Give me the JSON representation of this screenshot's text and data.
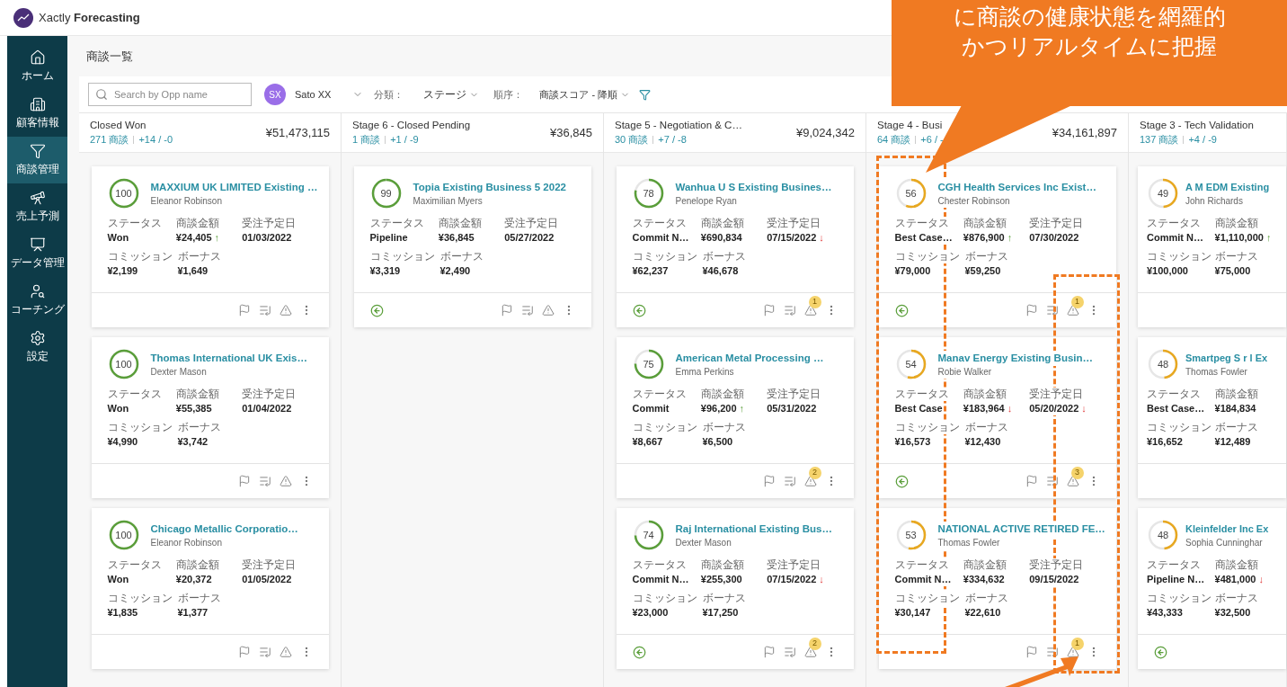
{
  "app": {
    "brand_light": "Xactly",
    "brand_bold": "Forecasting"
  },
  "sidebar": {
    "items": [
      {
        "label": "ホーム",
        "selected": false
      },
      {
        "label": "顧客情報",
        "selected": false
      },
      {
        "label": "商談管理",
        "selected": true
      },
      {
        "label": "売上予測",
        "selected": false
      },
      {
        "label": "データ管理",
        "selected": false
      },
      {
        "label": "コーチング",
        "selected": false
      },
      {
        "label": "設定",
        "selected": false
      }
    ]
  },
  "page_title": "商談一覧",
  "toolbar": {
    "search_placeholder": "Search by Opp name",
    "user_initials": "SX",
    "user_name": "Sato XX",
    "group_label": "分類：",
    "group_value": "ステージ",
    "order_label": "順序：",
    "order_value": "商談スコア - 降順"
  },
  "columns": [
    {
      "title": "Closed Won",
      "count": "271 商談",
      "delta": "+14 / -0",
      "amount": "¥51,473,115",
      "cards": [
        {
          "score": "100",
          "title": "MAXXIUM UK LIMITED Existing …",
          "owner": "Eleanor Robinson",
          "rows": [
            [
              {
                "label": "ステータス",
                "value": "Won"
              },
              {
                "label": "商談金額",
                "value": "¥24,405",
                "kind": "up",
                "arrow": "↑"
              },
              {
                "label": "受注予定日",
                "value": "01/03/2022"
              }
            ],
            [
              {
                "label": "コミッション",
                "value": "¥2,199"
              },
              {
                "label": "ボーナス",
                "value": "¥1,649"
              }
            ]
          ],
          "back": false,
          "tools": true
        },
        {
          "score": "100",
          "title": "Thomas International UK Exis…",
          "owner": "Dexter Mason",
          "rows": [
            [
              {
                "label": "ステータス",
                "value": "Won"
              },
              {
                "label": "商談金額",
                "value": "¥55,385"
              },
              {
                "label": "受注予定日",
                "value": "01/04/2022"
              }
            ],
            [
              {
                "label": "コミッション",
                "value": "¥4,990"
              },
              {
                "label": "ボーナス",
                "value": "¥3,742"
              }
            ]
          ],
          "back": false,
          "tools": true
        },
        {
          "score": "100",
          "title": "Chicago Metallic Corporatio…",
          "owner": "Eleanor Robinson",
          "rows": [
            [
              {
                "label": "ステータス",
                "value": "Won"
              },
              {
                "label": "商談金額",
                "value": "¥20,372"
              },
              {
                "label": "受注予定日",
                "value": "01/05/2022"
              }
            ],
            [
              {
                "label": "コミッション",
                "value": "¥1,835"
              },
              {
                "label": "ボーナス",
                "value": "¥1,377"
              }
            ]
          ],
          "back": false,
          "tools": true
        }
      ]
    },
    {
      "title": "Stage 6 - Closed Pending",
      "count": "1 商談",
      "delta": "+1 / -9",
      "amount": "¥36,845",
      "cards": [
        {
          "score": "99",
          "title": "Topia Existing Business 5 2022",
          "owner": "Maximilian Myers",
          "rows": [
            [
              {
                "label": "ステータス",
                "value": "Pipeline"
              },
              {
                "label": "商談金額",
                "value": "¥36,845"
              },
              {
                "label": "受注予定日",
                "value": "05/27/2022"
              }
            ],
            [
              {
                "label": "コミッション",
                "value": "¥3,319"
              },
              {
                "label": "ボーナス",
                "value": "¥2,490"
              }
            ]
          ],
          "back": true,
          "tools": true
        }
      ]
    },
    {
      "title": "Stage 5 - Negotiation & C…",
      "count": "30 商談",
      "delta": "+7 / -8",
      "amount": "¥9,024,342",
      "cards": [
        {
          "score": "78",
          "title": "Wanhua U S Existing Busines…",
          "owner": "Penelope Ryan",
          "rows": [
            [
              {
                "label": "ステータス",
                "value": "Commit N…"
              },
              {
                "label": "商談金額",
                "value": "¥690,834"
              },
              {
                "label": "受注予定日",
                "value": "07/15/2022",
                "kind": "down",
                "arrow": "↓"
              }
            ],
            [
              {
                "label": "コミッション",
                "value": "¥62,237"
              },
              {
                "label": "ボーナス",
                "value": "¥46,678"
              }
            ]
          ],
          "back": true,
          "tools": true,
          "alerts": "1"
        },
        {
          "score": "75",
          "title": "American Metal Processing …",
          "owner": "Emma Perkins",
          "rows": [
            [
              {
                "label": "ステータス",
                "value": "Commit"
              },
              {
                "label": "商談金額",
                "value": "¥96,200",
                "kind": "up",
                "arrow": "↑"
              },
              {
                "label": "受注予定日",
                "value": "05/31/2022"
              }
            ],
            [
              {
                "label": "コミッション",
                "value": "¥8,667"
              },
              {
                "label": "ボーナス",
                "value": "¥6,500"
              }
            ]
          ],
          "back": false,
          "tools": true,
          "alerts": "2"
        },
        {
          "score": "74",
          "title": "Raj International Existing Bus…",
          "owner": "Dexter Mason",
          "rows": [
            [
              {
                "label": "ステータス",
                "value": "Commit N…"
              },
              {
                "label": "商談金額",
                "value": "¥255,300"
              },
              {
                "label": "受注予定日",
                "value": "07/15/2022",
                "kind": "down",
                "arrow": "↓"
              }
            ],
            [
              {
                "label": "コミッション",
                "value": "¥23,000"
              },
              {
                "label": "ボーナス",
                "value": "¥17,250"
              }
            ]
          ],
          "back": true,
          "tools": true,
          "alerts": "2"
        }
      ]
    },
    {
      "title": "Stage 4 - Busi",
      "count": "64 商談",
      "delta": "+6 / -",
      "amount": "¥34,161,897",
      "cards": [
        {
          "score": "56",
          "title": "CGH Health Services Inc Exist…",
          "owner": "Chester Robinson",
          "rows": [
            [
              {
                "label": "ステータス",
                "value": "Best Case…"
              },
              {
                "label": "商談金額",
                "value": "¥876,900",
                "kind": "up",
                "arrow": "↑"
              },
              {
                "label": "受注予定日",
                "value": "07/30/2022"
              }
            ],
            [
              {
                "label": "コミッション",
                "value": "¥79,000"
              },
              {
                "label": "ボーナス",
                "value": "¥59,250"
              }
            ]
          ],
          "back": true,
          "tools": true,
          "alerts": "1"
        },
        {
          "score": "54",
          "title": "Manav Energy Existing Busin…",
          "owner": "Robie Walker",
          "rows": [
            [
              {
                "label": "ステータス",
                "value": "Best Case"
              },
              {
                "label": "商談金額",
                "value": "¥183,964",
                "kind": "down",
                "arrow": "↓"
              },
              {
                "label": "受注予定日",
                "value": "05/20/2022",
                "kind": "down",
                "arrow": "↓"
              }
            ],
            [
              {
                "label": "コミッション",
                "value": "¥16,573"
              },
              {
                "label": "ボーナス",
                "value": "¥12,430"
              }
            ]
          ],
          "back": true,
          "tools": true,
          "alerts": "3"
        },
        {
          "score": "53",
          "title": "NATIONAL ACTIVE RETIRED FE…",
          "owner": "Thomas Fowler",
          "rows": [
            [
              {
                "label": "ステータス",
                "value": "Commit N…"
              },
              {
                "label": "商談金額",
                "value": "¥334,632"
              },
              {
                "label": "受注予定日",
                "value": "09/15/2022"
              }
            ],
            [
              {
                "label": "コミッション",
                "value": "¥30,147"
              },
              {
                "label": "ボーナス",
                "value": "¥22,610"
              }
            ]
          ],
          "back": false,
          "tools": true,
          "alerts": "1"
        }
      ]
    },
    {
      "title": "Stage 3 - Tech Validation",
      "count": "137 商談",
      "delta": "+4 / -9",
      "cards": [
        {
          "score": "49",
          "title": "A M EDM Existing",
          "owner": "John Richards",
          "rows": [
            [
              {
                "label": "ステータス",
                "value": "Commit N…"
              },
              {
                "label": "商談金額",
                "value": "¥1,110,000",
                "kind": "up",
                "arrow": "↑"
              }
            ],
            [
              {
                "label": "コミッション",
                "value": "¥100,000"
              },
              {
                "label": "ボーナス",
                "value": "¥75,000"
              }
            ]
          ],
          "back": false,
          "tools": false
        },
        {
          "score": "48",
          "title": "Smartpeg S r l Ex",
          "owner": "Thomas Fowler",
          "rows": [
            [
              {
                "label": "ステータス",
                "value": "Best Case…"
              },
              {
                "label": "商談金額",
                "value": "¥184,834"
              }
            ],
            [
              {
                "label": "コミッション",
                "value": "¥16,652"
              },
              {
                "label": "ボーナス",
                "value": "¥12,489"
              }
            ]
          ],
          "back": false,
          "tools": false
        },
        {
          "score": "48",
          "title": "Kleinfelder Inc Ex",
          "owner": "Sophia Cunninghar",
          "rows": [
            [
              {
                "label": "ステータス",
                "value": "Pipeline N…"
              },
              {
                "label": "商談金額",
                "value": "¥481,000",
                "kind": "down",
                "arrow": "↓"
              }
            ],
            [
              {
                "label": "コミッション",
                "value": "¥43,333"
              },
              {
                "label": "ボーナス",
                "value": "¥32,500"
              }
            ]
          ],
          "back": true,
          "tools": false
        }
      ]
    }
  ],
  "callout": {
    "lines": [
      "に商談の健康状態を網羅的",
      "かつリアルタイムに把握"
    ]
  }
}
